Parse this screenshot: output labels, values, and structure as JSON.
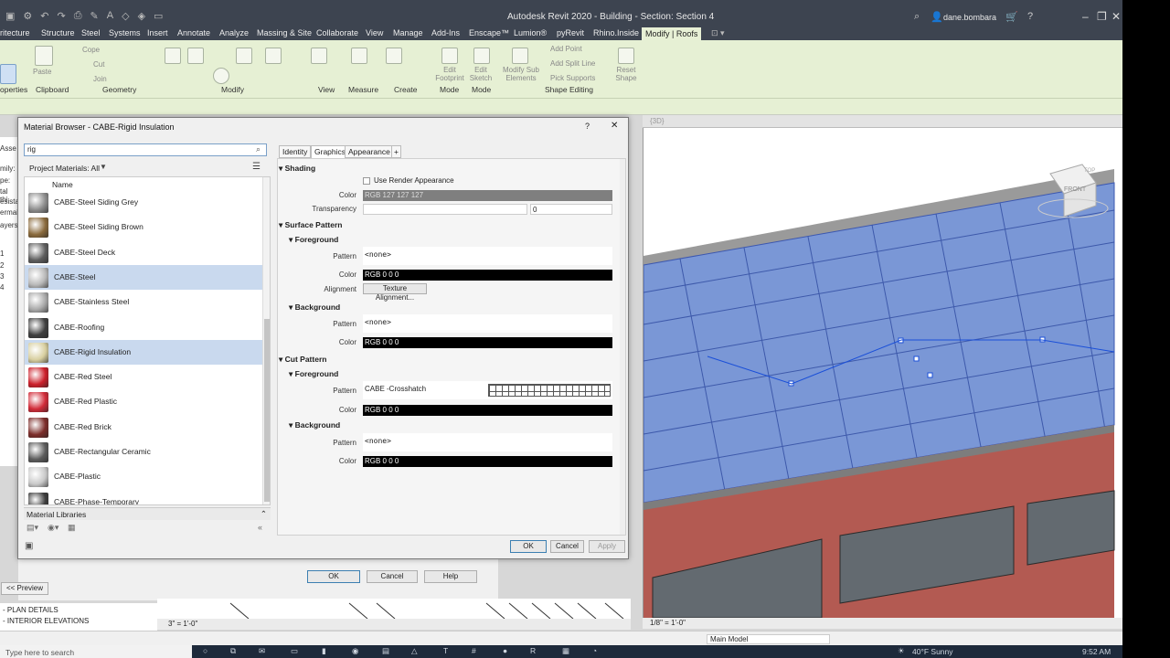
{
  "app": {
    "title": "Autodesk Revit 2020 - Building - Section: Section 4",
    "user": "dane.bombara"
  },
  "ribbon_tabs": [
    "ritecture",
    "Structure",
    "Steel",
    "Systems",
    "Insert",
    "Annotate",
    "Analyze",
    "Massing & Site",
    "Collaborate",
    "View",
    "Manage",
    "Add-Ins",
    "Enscape™",
    "Lumion®",
    "pyRevit",
    "Rhino.Inside",
    "Modify | Roofs"
  ],
  "ribbon_groups": [
    "operties",
    "Clipboard",
    "Geometry",
    "Modify",
    "View",
    "Measure",
    "Create",
    "Mode",
    "Mode",
    "Shape Editing"
  ],
  "ribbon_buttons": {
    "paste": "Paste",
    "cope": "Cope",
    "cut": "Cut",
    "join": "Join",
    "edit_footprint": "Edit Footprint",
    "edit_sketch": "Edit Sketch",
    "modify_sub": "Modify Sub Elements",
    "add_point": "Add Point",
    "add_split": "Add Split Line",
    "pick_supports": "Pick Supports",
    "reset_shape": "Reset Shape"
  },
  "props_strip": [
    "Asse",
    "mily:",
    "pe:",
    "tal thi",
    "esistan",
    "ermal",
    "ayers",
    "1",
    "2",
    "3",
    "4"
  ],
  "dialog": {
    "title": "Material Browser - CABE-Rigid Insulation",
    "help": "?",
    "close": "✕",
    "search_value": "rig",
    "project_materials": "Project Materials: All",
    "list_header": "Name",
    "materials": [
      {
        "name": "CABE-Steel Siding Grey",
        "color": "#8c8c8c"
      },
      {
        "name": "CABE-Steel Siding Brown",
        "color": "#8a6a3c"
      },
      {
        "name": "CABE-Steel Deck",
        "color": "#5e5e5e"
      },
      {
        "name": "CABE-Steel",
        "color": "#b9b9b9"
      },
      {
        "name": "CABE-Stainless Steel",
        "color": "#a9a9a9"
      },
      {
        "name": "CABE-Roofing",
        "color": "#3f3f3f"
      },
      {
        "name": "CABE-Rigid Insulation",
        "color": "#d8cfa0"
      },
      {
        "name": "CABE-Red Steel",
        "color": "#cc1f2a"
      },
      {
        "name": "CABE-Red Plastic",
        "color": "#d12b38"
      },
      {
        "name": "CABE-Red Brick",
        "color": "#7c2d2a"
      },
      {
        "name": "CABE-Rectangular Ceramic",
        "color": "#5c5c5c"
      },
      {
        "name": "CABE-Plastic",
        "color": "#c9c9c9"
      },
      {
        "name": "CABE-Phase-Temporary",
        "color": "#3c3c3c"
      }
    ],
    "selected_index": 6,
    "hover_index": 3,
    "material_libraries": "Material Libraries",
    "tabs": [
      "Identity",
      "Graphics",
      "Appearance",
      "+"
    ],
    "active_tab": "Graphics",
    "shading": {
      "header": "Shading",
      "use_render_label": "Use Render Appearance",
      "color_label": "Color",
      "color_value": "RGB 127 127 127",
      "transparency_label": "Transparency",
      "transparency_value": "0"
    },
    "surface_pattern": {
      "header": "Surface Pattern",
      "foreground": "Foreground",
      "fg_pattern_label": "Pattern",
      "fg_pattern_value": "<none>",
      "fg_color_label": "Color",
      "fg_color_value": "RGB 0 0 0",
      "alignment_label": "Alignment",
      "alignment_button": "Texture Alignment...",
      "background": "Background",
      "bg_pattern_label": "Pattern",
      "bg_pattern_value": "<none>",
      "bg_color_label": "Color",
      "bg_color_value": "RGB 0 0 0"
    },
    "cut_pattern": {
      "header": "Cut Pattern",
      "foreground": "Foreground",
      "fg_pattern_label": "Pattern",
      "fg_pattern_value": "CABE -Crosshatch",
      "fg_color_label": "Color",
      "fg_color_value": "RGB 0 0 0",
      "background": "Background",
      "bg_pattern_label": "Pattern",
      "bg_pattern_value": "<none>",
      "bg_color_label": "Color",
      "bg_color_value": "RGB 0 0 0"
    },
    "ok": "OK",
    "cancel": "Cancel",
    "apply": "Apply"
  },
  "sub_dialog": {
    "ok": "OK",
    "cancel": "Cancel",
    "help": "Help",
    "preview": "<< Preview"
  },
  "browser_items": [
    "- PLAN DETAILS",
    "- INTERIOR ELEVATIONS"
  ],
  "view3d": {
    "tab": "{3D}",
    "viewcube_face": "FRONT",
    "viewcube_top": "TOP",
    "scale": "1/8\" = 1'-0\""
  },
  "section_scale": "3\" = 1'-0\"",
  "status": {
    "model": "Main Model"
  },
  "taskbar": {
    "search_placeholder": "Type here to search",
    "weather": "40°F  Sunny",
    "time": "9:52 AM"
  }
}
